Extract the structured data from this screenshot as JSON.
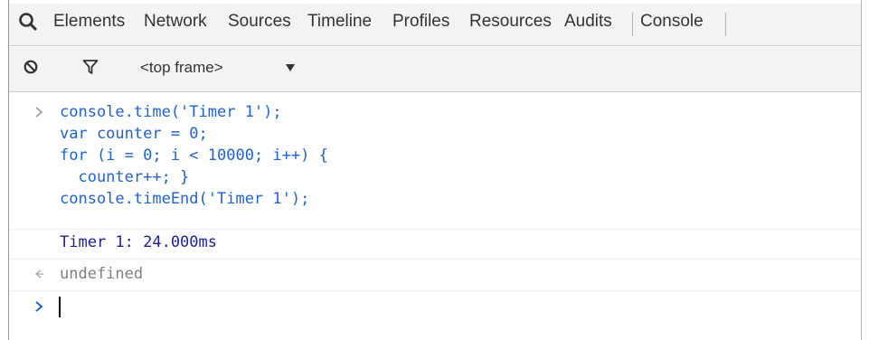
{
  "toolbar": {
    "tabs": [
      {
        "label": "Elements"
      },
      {
        "label": "Network"
      },
      {
        "label": "Sources"
      },
      {
        "label": "Timeline"
      },
      {
        "label": "Profiles"
      },
      {
        "label": "Resources"
      },
      {
        "label": "Audits"
      },
      {
        "label": "Console",
        "selected": true
      }
    ]
  },
  "console_toolbar": {
    "frame_selector": "<top frame>"
  },
  "console": {
    "input_lines": [
      "console.time('Timer 1');",
      "var counter = 0;",
      "for (i = 0; i < 10000; i++) {",
      "  counter++; }",
      "console.timeEnd('Timer 1');"
    ],
    "log_output": "Timer 1: 24.000ms",
    "return_value": "undefined",
    "prompt_value": ""
  },
  "colors": {
    "code": "#1d62d6",
    "log": "#1b1f9e",
    "return": "#7f7f7f",
    "toolbar_bg": "#f3f3f3"
  }
}
